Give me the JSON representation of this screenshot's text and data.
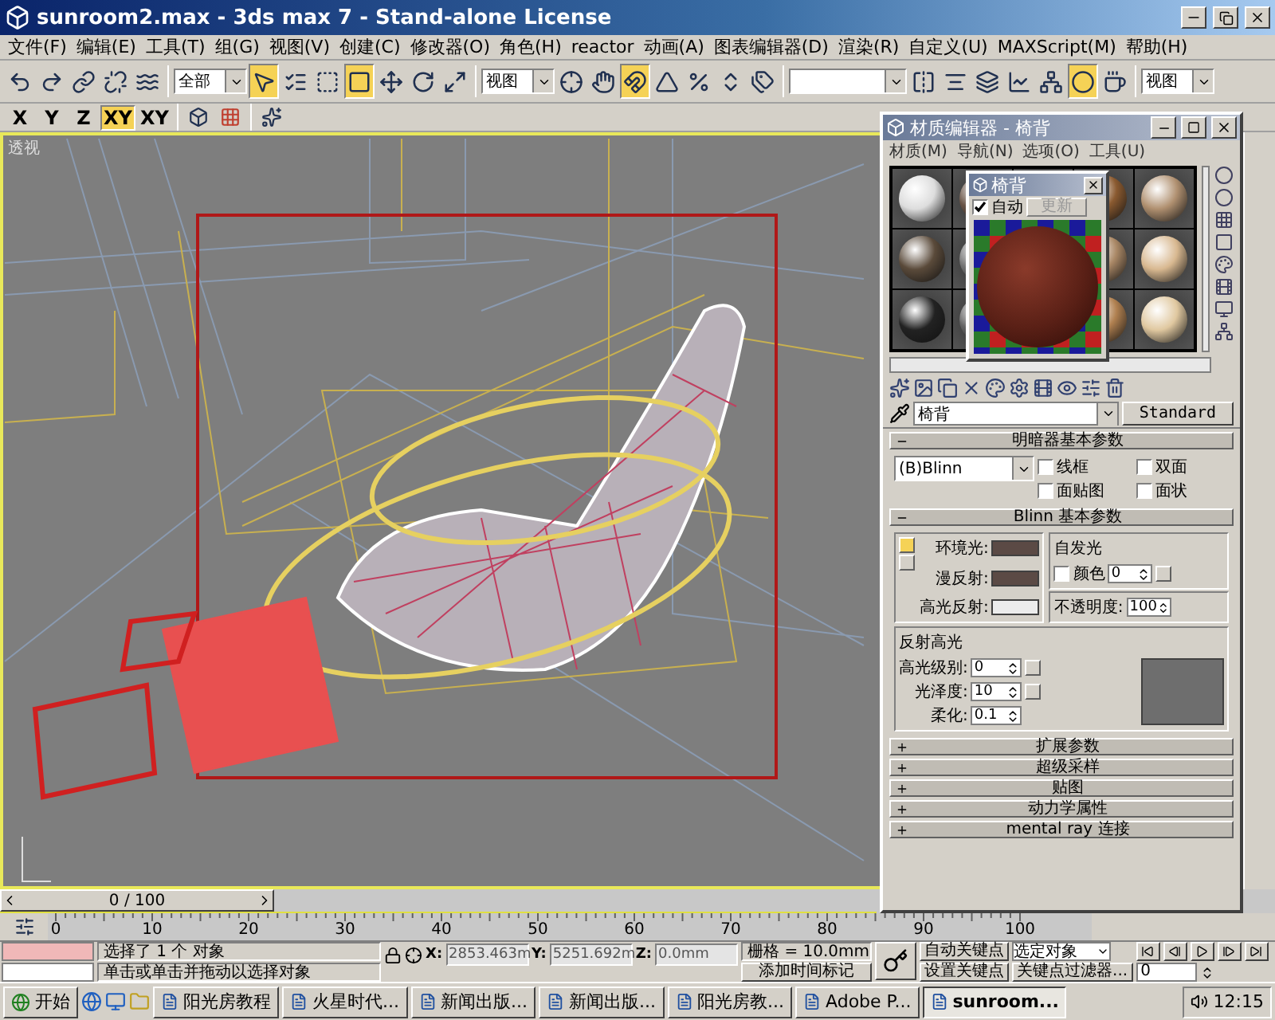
{
  "window": {
    "title": "sunroom2.max - 3ds max 7  - Stand-alone License"
  },
  "menu": [
    "文件(F)",
    "编辑(E)",
    "工具(T)",
    "组(G)",
    "视图(V)",
    "创建(C)",
    "修改器(O)",
    "角色(H)",
    "reactor",
    "动画(A)",
    "图表编辑器(D)",
    "渲染(R)",
    "自定义(U)",
    "MAXScript(M)",
    "帮助(H)"
  ],
  "main_toolbar": [
    {
      "kind": "button",
      "selected": false
    },
    {
      "kind": "button",
      "selected": false
    },
    {
      "kind": "button",
      "selected": false
    },
    {
      "kind": "button",
      "selected": false
    },
    {
      "kind": "button",
      "selected": false
    },
    {
      "kind": "dropdown",
      "value": "全部"
    },
    {
      "kind": "button",
      "selected": true
    },
    {
      "kind": "button",
      "selected": false
    },
    {
      "kind": "button",
      "selected": false
    },
    {
      "kind": "button",
      "selected": true
    },
    {
      "kind": "button",
      "selected": false
    },
    {
      "kind": "button",
      "selected": false
    },
    {
      "kind": "button",
      "selected": false
    },
    {
      "kind": "dropdown",
      "value": "视图"
    },
    {
      "kind": "button",
      "selected": false
    },
    {
      "kind": "button",
      "selected": false
    },
    {
      "kind": "button",
      "selected": true
    },
    {
      "kind": "button",
      "selected": false
    },
    {
      "kind": "button",
      "selected": false
    },
    {
      "kind": "button",
      "selected": false
    },
    {
      "kind": "button",
      "selected": false
    },
    {
      "kind": "dropdown"
    },
    {
      "kind": "button",
      "selected": false
    },
    {
      "kind": "button",
      "selected": false
    },
    {
      "kind": "button",
      "selected": false
    },
    {
      "kind": "button",
      "selected": false
    },
    {
      "kind": "button",
      "selected": false
    },
    {
      "kind": "button",
      "selected": true
    },
    {
      "kind": "button",
      "selected": false
    },
    {
      "kind": "dropdown",
      "value": "视图"
    }
  ],
  "axis_toolbar": [
    {
      "label": "X",
      "selected": false
    },
    {
      "label": "Y",
      "selected": false
    },
    {
      "label": "Z",
      "selected": false
    },
    {
      "label": "XY",
      "selected": true
    },
    {
      "label": "XY",
      "selected": false
    }
  ],
  "viewport": {
    "label": "透视"
  },
  "material_editor": {
    "title": "材质编辑器 - 椅背",
    "menu": [
      "材质(M)",
      "导航(N)",
      "选项(O)",
      "工具(U)"
    ],
    "preview": {
      "title": "椅背",
      "auto": {
        "label": "自动",
        "checked": true
      },
      "update": {
        "label": "更新",
        "disabled": true
      }
    },
    "material_name": "椅背",
    "material_type": "Standard",
    "shader_rollout": {
      "title": "明暗器基本参数",
      "expanded": true,
      "shader": "(B)Blinn",
      "options": [
        {
          "label": "线框",
          "checked": false
        },
        {
          "label": "双面",
          "checked": false
        },
        {
          "label": "面贴图",
          "checked": false
        },
        {
          "label": "面状",
          "checked": false
        }
      ]
    },
    "blinn_rollout": {
      "title": "Blinn 基本参数",
      "expanded": true,
      "colors": [
        {
          "label": "环境光:",
          "color": "#5b4a45"
        },
        {
          "label": "漫反射:",
          "color": "#5b4a45"
        },
        {
          "label": "高光反射:",
          "color": "#ececec"
        }
      ],
      "self_illumination": {
        "title": "自发光",
        "checkbox": {
          "label": "颜色",
          "checked": false
        },
        "value": "0"
      },
      "opacity": {
        "label": "不透明度:",
        "value": "100"
      },
      "specular": {
        "title": "反射高光",
        "params": [
          {
            "label": "高光级别:",
            "value": "0"
          },
          {
            "label": "光泽度:",
            "value": "10"
          },
          {
            "label": "柔化:",
            "value": "0.1"
          }
        ]
      }
    },
    "collapsed_rollouts": [
      {
        "title": "扩展参数",
        "expanded": false
      },
      {
        "title": "超级采样",
        "expanded": false
      },
      {
        "title": "贴图",
        "expanded": false
      },
      {
        "title": "动力学属性",
        "expanded": false
      },
      {
        "title": "mental ray 连接",
        "expanded": false
      }
    ]
  },
  "time_slider": {
    "label": "0 / 100",
    "level": 0
  },
  "track_ticks": [
    "0",
    "10",
    "20",
    "30",
    "40",
    "50",
    "60",
    "70",
    "80",
    "90",
    "100"
  ],
  "status": {
    "selection": "选择了 1 个 对象",
    "prompt": "单击或单击并拖动以选择对象",
    "coords": [
      {
        "label": "X:",
        "value": "2853.463m"
      },
      {
        "label": "Y:",
        "value": "5251.692m"
      },
      {
        "label": "Z:",
        "value": "0.0mm"
      }
    ],
    "grid": "栅格 = 10.0mm",
    "add_time_tag": "添加时间标记",
    "auto_key": "自动关键点",
    "key_mode": "选定对象",
    "set_key": "设置关键点",
    "key_filters": "关键点过滤器...",
    "frame": "0"
  },
  "taskbar": {
    "start": "开始",
    "tasks": [
      {
        "label": "阳光房教程",
        "selected": false
      },
      {
        "label": "火星时代...",
        "selected": false
      },
      {
        "label": "新闻出版...",
        "selected": false
      },
      {
        "label": "新闻出版...",
        "selected": false
      },
      {
        "label": "阳光房教...",
        "selected": false
      },
      {
        "label": "Adobe P...",
        "selected": false
      },
      {
        "label": "sunroom...",
        "selected": true
      }
    ],
    "clock": "12:15"
  }
}
